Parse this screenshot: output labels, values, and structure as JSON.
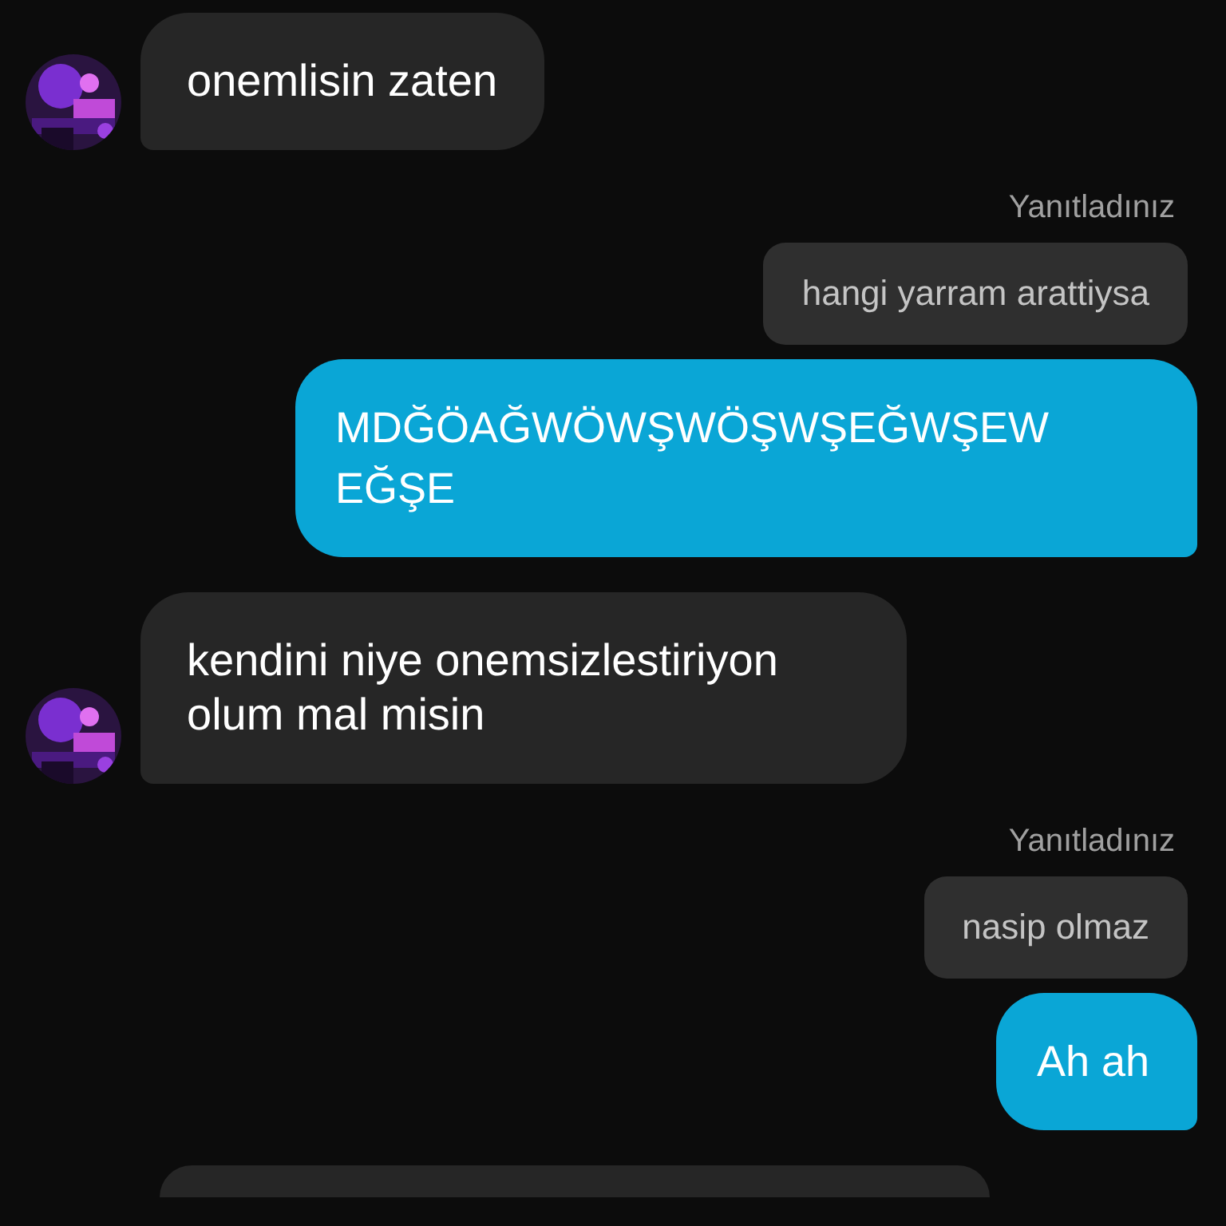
{
  "messages": [
    {
      "kind": "incoming",
      "text": "onemlisin zaten",
      "avatar": true
    },
    {
      "kind": "reply_label",
      "text": "Yanıtladınız"
    },
    {
      "kind": "quote",
      "text": "hangi yarram arattiysa"
    },
    {
      "kind": "outgoing",
      "text": "MDĞÖAĞWÖWŞWÖŞWŞEĞWŞEW EĞŞE"
    },
    {
      "kind": "incoming",
      "text": "kendini niye onemsizlestiriyon olum mal misin",
      "avatar": true
    },
    {
      "kind": "reply_label",
      "text": "Yanıtladınız"
    },
    {
      "kind": "quote",
      "text": "nasip olmaz"
    },
    {
      "kind": "outgoing",
      "text": "Ah ah"
    },
    {
      "kind": "incoming",
      "avatar": false
    }
  ]
}
